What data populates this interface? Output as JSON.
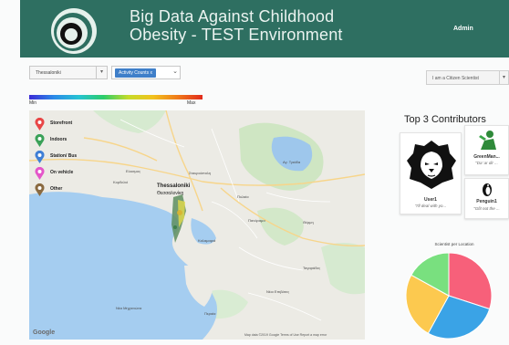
{
  "header": {
    "title_line1": "Big Data Against Childhood",
    "title_line2": "Obesity - TEST Environment",
    "user_label": "Admin",
    "bg_color": "#2e6f61"
  },
  "filters": {
    "city_value": "Thessaloniki",
    "metric_chip": "Activity Counts x",
    "role_value": "I am a Citizen Scientist"
  },
  "gradient_legend": {
    "min_label": "Min",
    "max_label": "Max"
  },
  "map": {
    "legend": [
      {
        "label": "Storefront",
        "color": "#e84646",
        "icon": "storefront-pin"
      },
      {
        "label": "Indoors",
        "color": "#3aa158",
        "icon": "indoors-pin"
      },
      {
        "label": "Station/ Bus",
        "color": "#3f7fd6",
        "icon": "station-bus-pin"
      },
      {
        "label": "On vehicle",
        "color": "#e456c9",
        "icon": "vehicle-pin"
      },
      {
        "label": "Other",
        "color": "#8a6a40",
        "icon": "other-pin"
      }
    ],
    "city_label": "Thessaloniki",
    "city_label_gr": "Θεσσαλονίκη",
    "place_labels": [
      "Καλαμαριά",
      "Πυλαία",
      "Θέρμη",
      "Πανόραμα",
      "Εύοσμος",
      "Κορδελιό",
      "Σταυρούπολη",
      "Νέα Μηχανιώνα",
      "Περαία",
      "Νέοι Επιβάτες",
      "Ταγαράδες",
      "Αγ. Τριάδα"
    ],
    "google_label": "Google",
    "attribution": "Map data ©2019 Google   Terms of Use   Report a map error"
  },
  "contributors": {
    "heading": "Top 3 Contributors",
    "items": [
      {
        "name": "User1",
        "quote": "\"I'll deal with yo...",
        "icon": "lion-avatar-icon"
      },
      {
        "name": "GreenMan...",
        "quote": "\"Da' ar dir ...",
        "icon": "green-figure-icon"
      },
      {
        "name": "Penguin1",
        "quote": "\"Gfit not the ...",
        "icon": "penguin-icon"
      }
    ]
  },
  "chart_data": {
    "type": "pie",
    "title": "Scientist per Location",
    "slices": [
      {
        "value": 30,
        "color": "#f7607a"
      },
      {
        "value": 28,
        "color": "#3aa3e6"
      },
      {
        "value": 25,
        "color": "#fcc94f"
      },
      {
        "value": 17,
        "color": "#79e07f"
      }
    ]
  }
}
